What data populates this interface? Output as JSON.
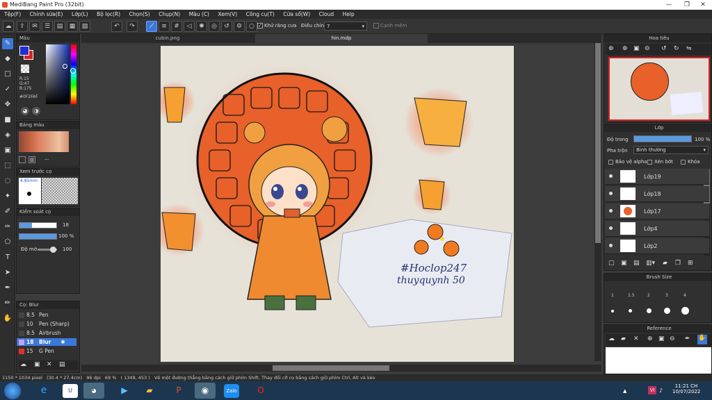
{
  "window": {
    "title": "MediBang Paint Pro (32bit)",
    "minimize": "—",
    "maximize": "❐",
    "close": "✕"
  },
  "menu": [
    "Tệp(F)",
    "Chỉnh sửa(E)",
    "Lớp(L)",
    "Bộ lọc(R)",
    "Chọn(S)",
    "Chụp(N)",
    "Màu (C)",
    "Xem(V)",
    "Công cụ(T)",
    "Cửa sổ(W)",
    "Cloud",
    "Help"
  ],
  "toolbar": {
    "antialias_label": "Khử răng cưa",
    "correction_label": "Điều chỉnh",
    "correction_value": "7",
    "snap_label": "Cạnh mềm"
  },
  "tabs": [
    "cubin.png",
    "hin.mdp"
  ],
  "color_panel": {
    "title": "Màu",
    "r": "R:15",
    "g": "G:47",
    "b": "B:175",
    "hex": "#0F2FAF"
  },
  "swatch_panel": {
    "title": "Bảng màu",
    "extra": "---"
  },
  "brush_preview": {
    "title": "Xem trước cọ",
    "size": "4.85mm"
  },
  "brush_control": {
    "title": "Kiểm soát cọ",
    "size_value": "18",
    "opacity_value": "100 %",
    "blur_label": "Độ mờ",
    "blur_value": "100"
  },
  "brush_list": {
    "title": "Cọ: Blur",
    "items": [
      {
        "size": "8.5",
        "name": "Pen"
      },
      {
        "size": "10",
        "name": "Pen (Sharp)"
      },
      {
        "size": "8.5",
        "name": "Airbrush"
      },
      {
        "size": "18",
        "name": "Blur"
      },
      {
        "size": "15",
        "name": "G Pen"
      }
    ]
  },
  "navigator": {
    "title": "Hoa tiêu"
  },
  "layers_panel": {
    "title": "Lớp",
    "opacity_label": "Độ trong",
    "opacity_value": "100 %",
    "blend_label": "Pha trộn",
    "blend_value": "Bình thường",
    "protect_alpha": "Bảo vệ alpha",
    "clipping": "Xén bớt",
    "lock": "Khóa",
    "layers": [
      "Lớp19",
      "Lớp18",
      "Lớp17",
      "Lớp4",
      "Lớp2"
    ]
  },
  "brush_size_panel": {
    "title": "Brush Size",
    "sizes": [
      "1",
      "1.5",
      "2",
      "3",
      "4"
    ]
  },
  "reference_panel": {
    "title": "Reference"
  },
  "status": {
    "dimensions": "1150 * 1034 pixel",
    "physical": "(30.4 * 27.4cm)",
    "dpi": "96 dpi",
    "zoom": "69 %",
    "cursor": "( 1349, 453 )",
    "hint": "Vẽ một đường thẳng bằng cách giữ phím Shift, Thay đổi cỡ cọ bằng cách giữ phím Ctrl, Alt và kéo"
  },
  "artwork": {
    "handwriting_line1": "#Hoclop247",
    "handwriting_line2": "thuyquynh 50"
  },
  "taskbar": {
    "apps": [
      "Zalo"
    ],
    "lang": "VI",
    "time": "11:21 CH",
    "date": "10/07/2022"
  },
  "colors": {
    "accent": "#3c78d8",
    "fg_color": "#1f2fd0",
    "bg_color": "#e02020"
  }
}
